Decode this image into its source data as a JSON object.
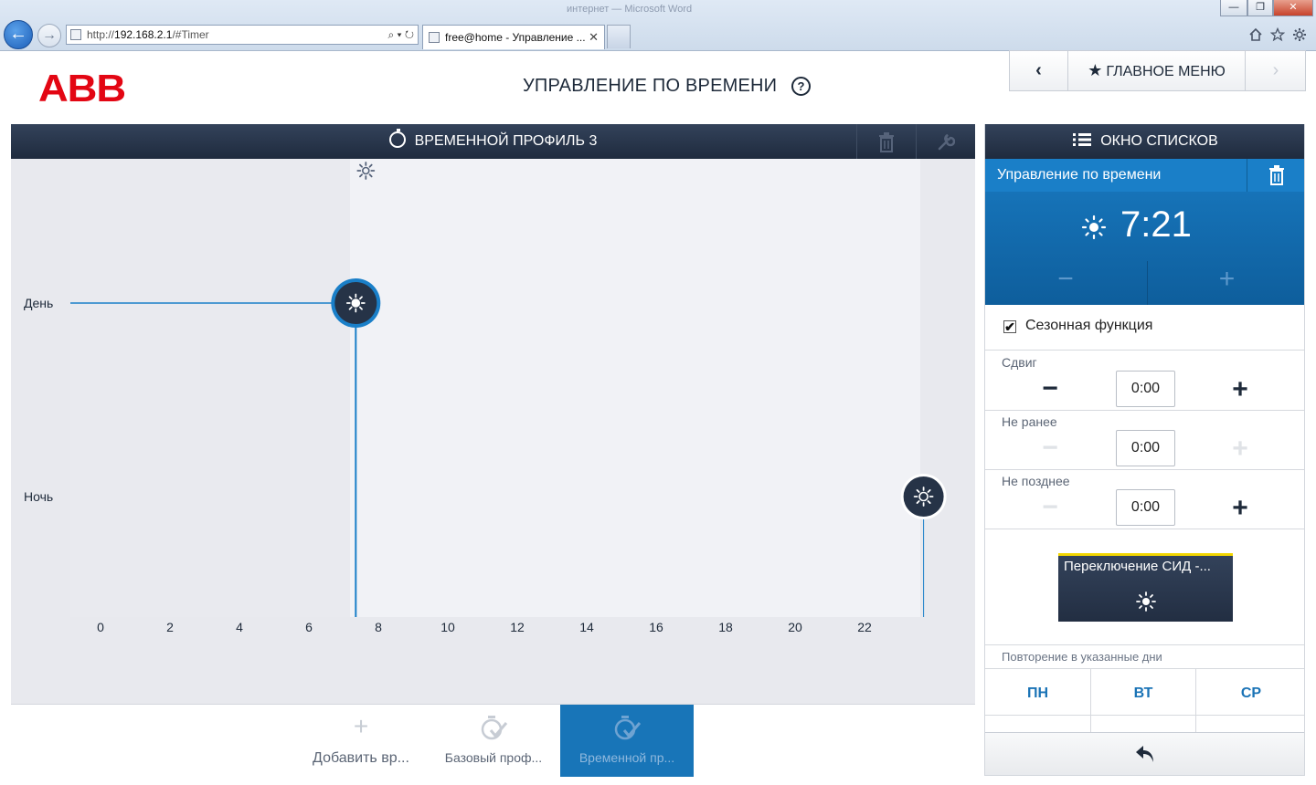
{
  "browser": {
    "window_title": "интернет — Microsoft Word",
    "url_prefix": "http://",
    "url_host": "192.168.2.1",
    "url_path": "/#Timer",
    "tab_title": "free@home - Управление ...",
    "win_minimize": "—",
    "win_maximize": "❐",
    "win_close": "✕",
    "back_glyph": "←",
    "forward_glyph": "→",
    "addr_tools": "⌕ ▾ ↻",
    "tab_close": "✕",
    "icons": [
      "home-icon",
      "star-icon",
      "gear-icon"
    ]
  },
  "header": {
    "logo": "ABB",
    "title": "УПРАВЛЕНИЕ ПО ВРЕМЕНИ",
    "help": "?",
    "nav_back": "‹",
    "nav_main": "ГЛАВНОЕ МЕНЮ",
    "nav_forward": "›"
  },
  "profile": {
    "title": "ВРЕМЕННОЙ ПРОФИЛЬ 3"
  },
  "chart_data": {
    "type": "line",
    "y_categories": [
      "День",
      "Ночь"
    ],
    "x_ticks": [
      0,
      2,
      4,
      6,
      8,
      10,
      12,
      14,
      16,
      18,
      20,
      22
    ],
    "xlim": [
      0,
      24
    ],
    "events": [
      {
        "time": 7.35,
        "state": "День",
        "icon": "sun-icon",
        "selected": true
      },
      {
        "time": 23.7,
        "state": "Ночь",
        "icon": "sun-outline-icon",
        "selected": false
      }
    ],
    "series": [
      {
        "name": "",
        "segments": [
          {
            "x": [
              0,
              7.35
            ],
            "state": "День"
          }
        ]
      }
    ],
    "marker_top_time": 7.35
  },
  "bottom_bar": {
    "add_label": "Добавить вр...",
    "base_label": "Базовый проф...",
    "time_label": "Временной пр..."
  },
  "list_panel": {
    "header": "ОКНО СПИСКОВ",
    "item_title": "Управление по времени",
    "time": "7:21",
    "minus": "−",
    "plus": "+",
    "season_label": "Сезонная функция",
    "season_checked": "✔",
    "rows": [
      {
        "label": "Сдвиг",
        "value": "0:00",
        "minus_active": true,
        "plus_active": true
      },
      {
        "label": "Не ранее",
        "value": "0:00",
        "minus_active": false,
        "plus_active": false
      },
      {
        "label": "Не позднее",
        "value": "0:00",
        "minus_active": false,
        "plus_active": true
      }
    ],
    "switch_card_label": "Переключение СИД -...",
    "repeat_label": "Повторение в указанные дни",
    "days": [
      "ПН",
      "ВТ",
      "СР"
    ]
  },
  "colors": {
    "accent_blue": "#1a7fc8",
    "header_dark": "#2a374c",
    "abb_red": "#e30613",
    "card_yellow": "#f2d600"
  }
}
